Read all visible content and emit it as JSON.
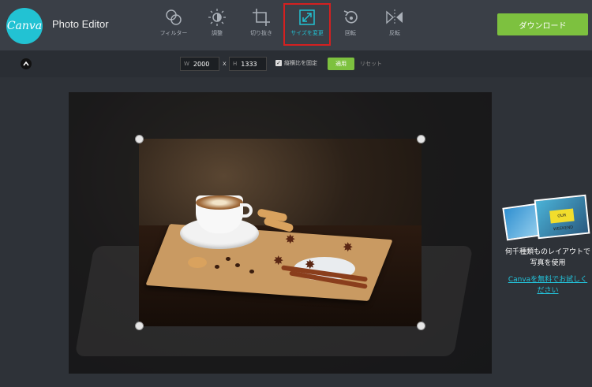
{
  "header": {
    "logo_text": "Canva",
    "app_title": "Photo Editor",
    "download_label": "ダウンロード",
    "tools": [
      {
        "label": "フィルター",
        "icon": "filter-icon"
      },
      {
        "label": "調整",
        "icon": "adjust-icon"
      },
      {
        "label": "切り抜き",
        "icon": "crop-icon"
      },
      {
        "label": "サイズを変更",
        "icon": "resize-icon",
        "active": true
      },
      {
        "label": "回転",
        "icon": "rotate-icon"
      },
      {
        "label": "反転",
        "icon": "flip-icon"
      }
    ]
  },
  "resize_bar": {
    "width_prefix": "W",
    "width_value": "2000",
    "times": "x",
    "height_prefix": "H",
    "height_value": "1333",
    "lock_label": "縦横比を固定",
    "lock_checked": true,
    "apply_label": "適用",
    "reset_label": "リセット"
  },
  "promo": {
    "text": "何千種類ものレイアウトで写真を使用",
    "link": "Canvaを無料でお試しください",
    "image_tag": "OUR WEEKEND"
  },
  "colors": {
    "accent": "#22c2d3",
    "button_green": "#7dc13f",
    "active_outline": "#d42020"
  }
}
